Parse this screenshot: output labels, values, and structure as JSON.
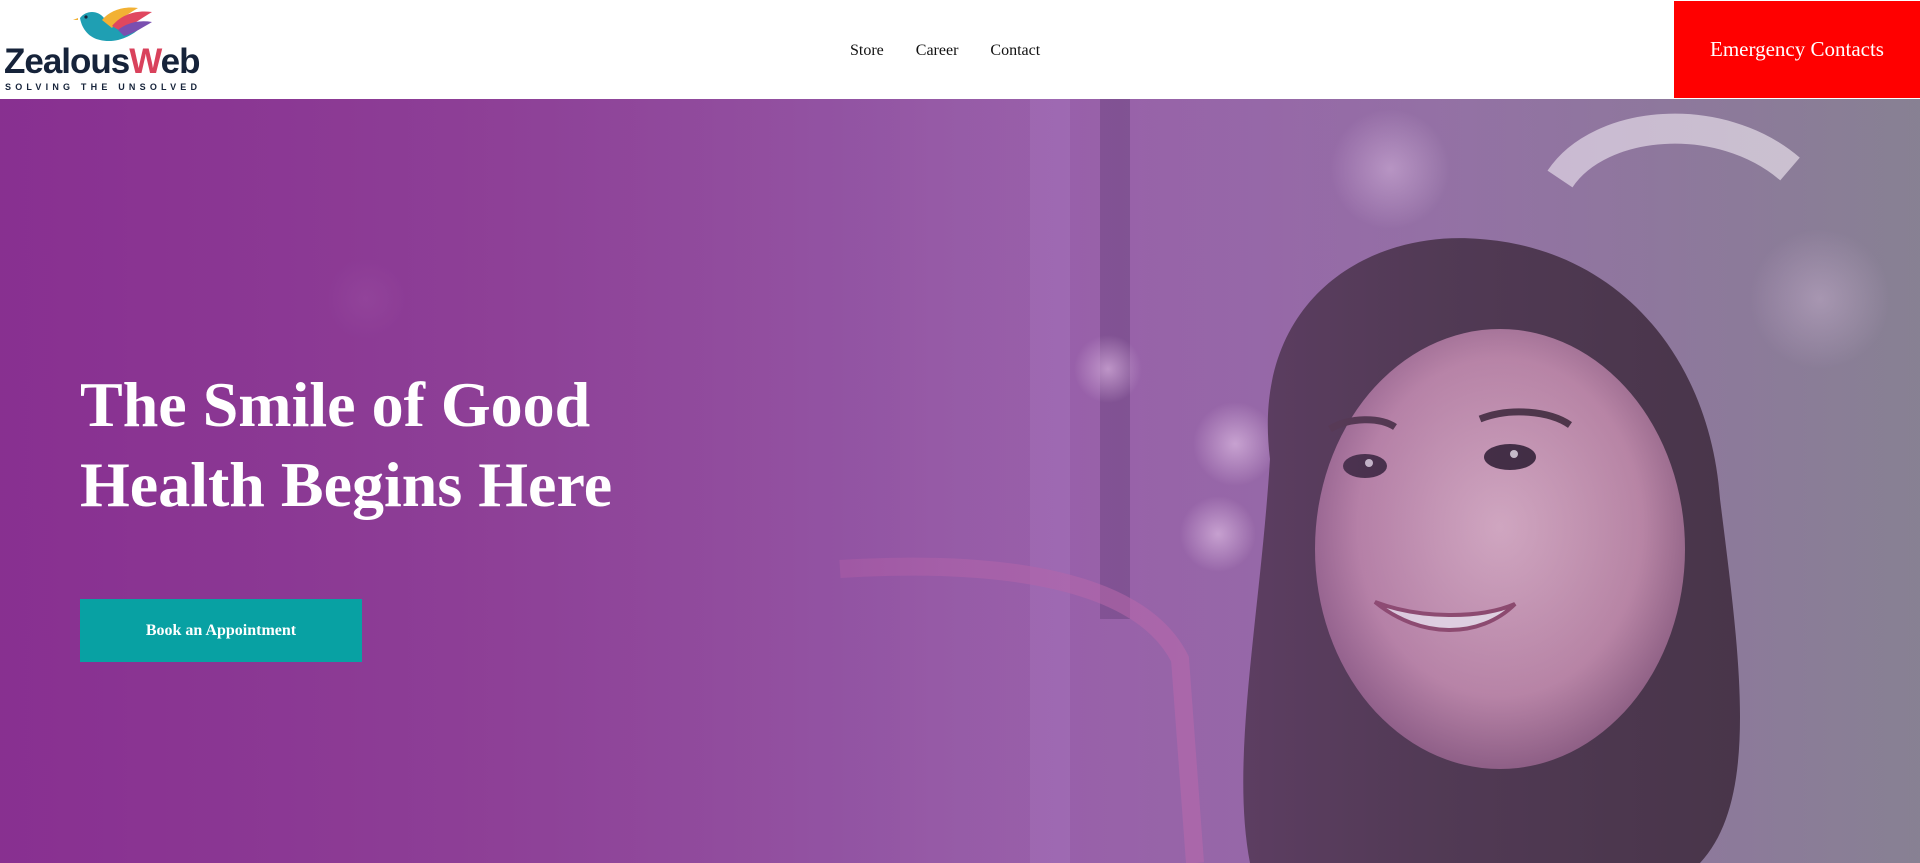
{
  "header": {
    "logo": {
      "wordmark_part1": "Zealous",
      "wordmark_part2": "Web",
      "tagline": "SOLVING THE UNSOLVED",
      "icon": "bird-logo-icon"
    },
    "nav": [
      {
        "label": "Store"
      },
      {
        "label": "Career"
      },
      {
        "label": "Contact"
      }
    ],
    "emergency_label": "Emergency Contacts"
  },
  "hero": {
    "title_line1": "The Smile of Good",
    "title_line2": "Health Begins Here",
    "cta_label": "Book an Appointment",
    "image": "smiling-girl-photo"
  },
  "colors": {
    "emergency_bg": "#ff0000",
    "cta_bg": "#08a1a3",
    "hero_purple": "#893091",
    "logo_navy": "#16233a"
  }
}
